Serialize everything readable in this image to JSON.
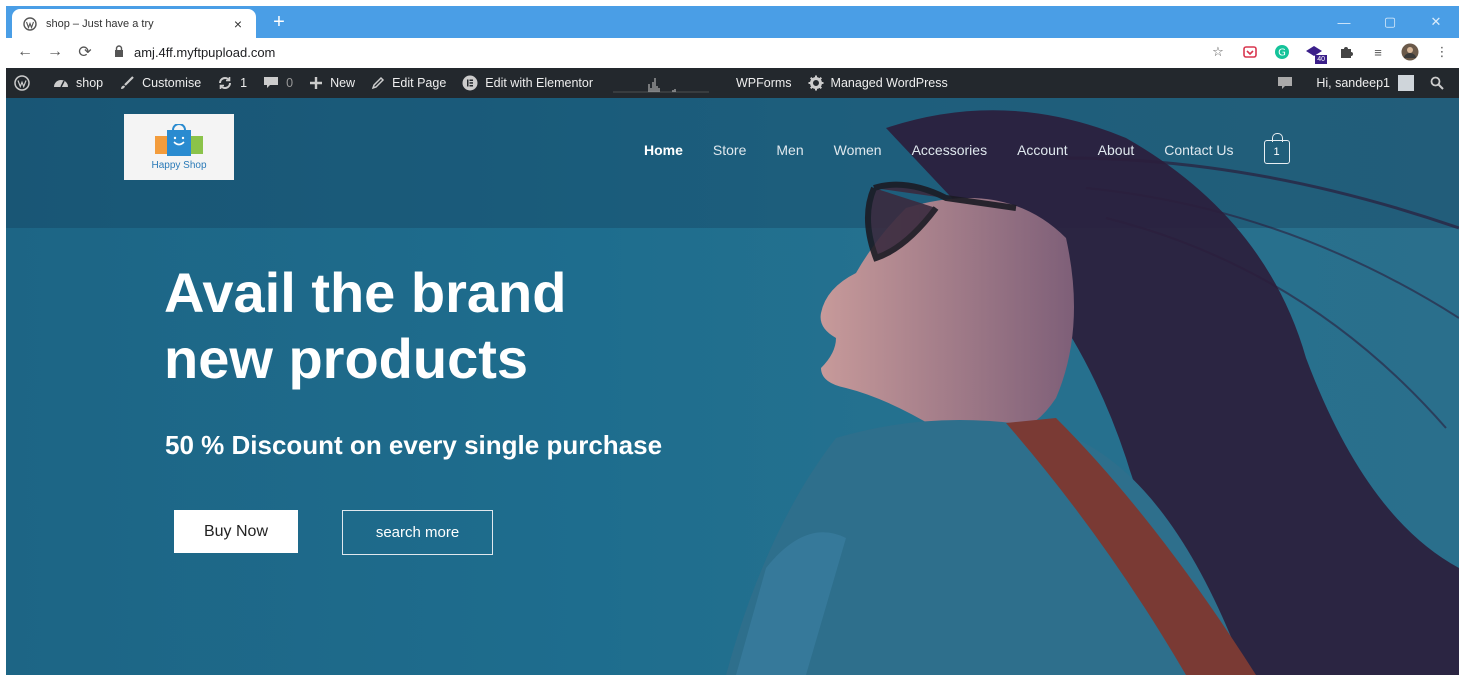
{
  "browser": {
    "tab_title": "shop – Just have a try",
    "tab_close": "×",
    "new_tab": "+",
    "url": "amj.4ff.myftpupload.com"
  },
  "extensions": {
    "badge_count": "40"
  },
  "admin_bar": {
    "site": "shop",
    "customise": "Customise",
    "updates": "1",
    "comments": "0",
    "new": "New",
    "edit_page": "Edit Page",
    "elementor": "Edit with Elementor",
    "wpforms": "WPForms",
    "managed": "Managed WordPress",
    "greeting": "Hi, sandeep1"
  },
  "site": {
    "logo_text": "Happy Shop",
    "nav": [
      "Home",
      "Store",
      "Men",
      "Women",
      "Accessories",
      "Account",
      "About",
      "Contact Us"
    ],
    "cart_count": "1"
  },
  "hero": {
    "headline_line1": "Avail the brand",
    "headline_line2": "new products",
    "subheadline": "50 % Discount on every single purchase",
    "buy_button": "Buy Now",
    "search_button": "search more"
  },
  "colors": {
    "tab_strip": "#4a9ee6",
    "admin_bar": "#23282d",
    "hero_bg": "#1e6d8e"
  }
}
